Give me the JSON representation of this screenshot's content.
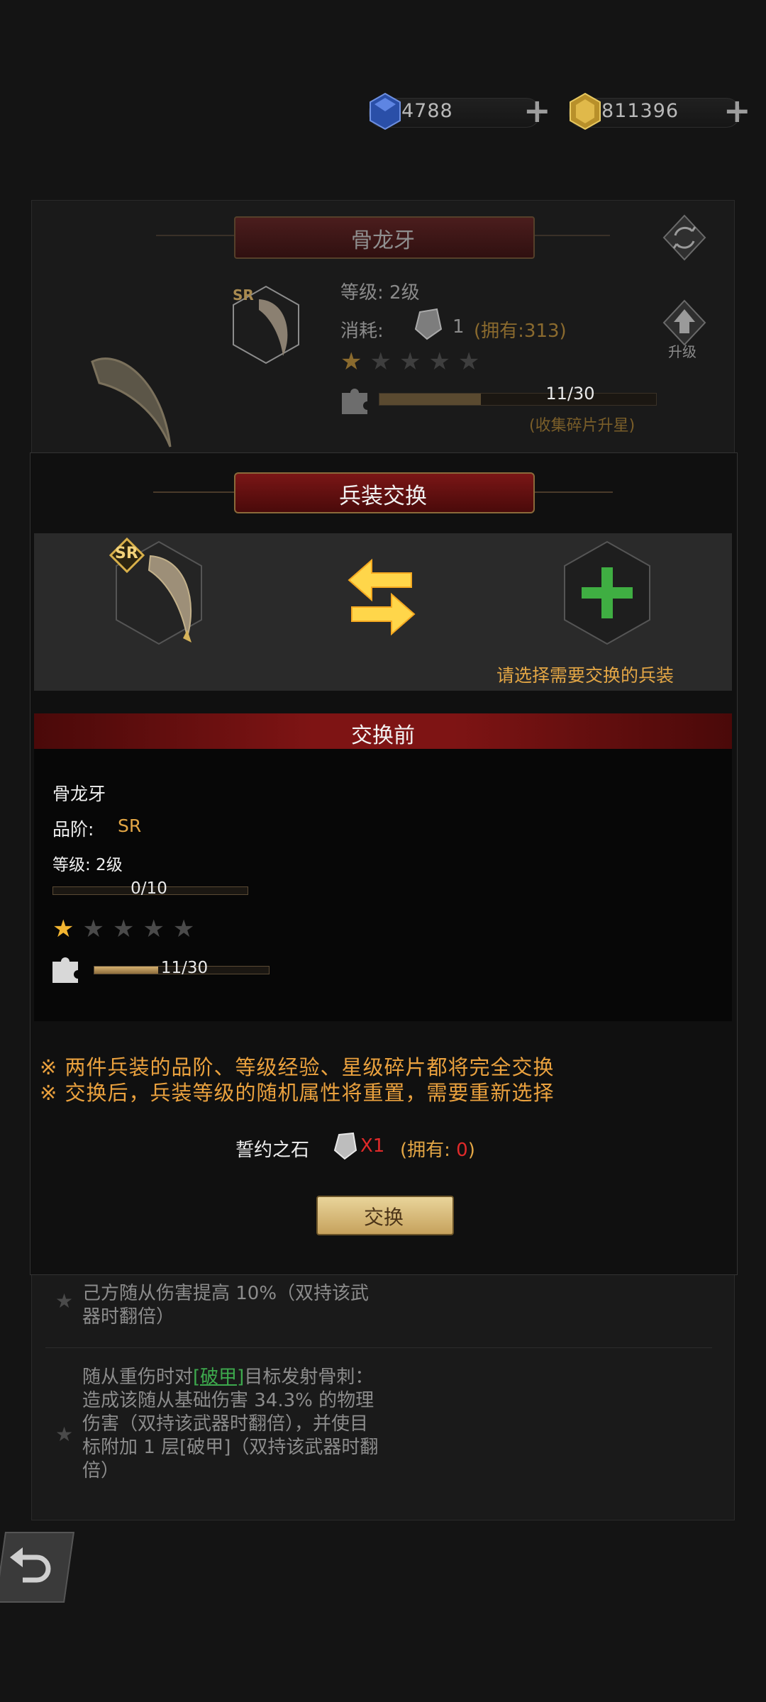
{
  "currency": {
    "gems": "4788",
    "gold": "811396"
  },
  "item_panel": {
    "title": "骨龙牙",
    "rarity_badge": "SR",
    "level_label": "等级: 2级",
    "cost_label": "消耗:",
    "cost_amount": "1",
    "cost_owned": "(拥有:313)",
    "stars_filled": 1,
    "stars_total": 5,
    "fragments": "11/30",
    "fragments_progress": 0.3667,
    "fragment_hint": "(收集碎片升星)",
    "upgrade_label": "升级",
    "bonuses": [
      {
        "text": "己方随从伤害提高 10%（双持该武器时翻倍）"
      },
      {
        "before": "随从重伤时对",
        "link": "[破甲]",
        "after": "目标发射骨刺：造成该随从基础伤害 34.3% 的物理伤害（双持该武器时翻倍），并使目标附加 1 层[破甲]（双持该武器时翻倍）"
      }
    ]
  },
  "modal": {
    "title": "兵装交换",
    "select_hint": "请选择需要交换的兵装",
    "before_header": "交换前",
    "before": {
      "name": "骨龙牙",
      "quality_label": "品阶:",
      "quality_value": "SR",
      "level": "等级: 2级",
      "exp": "0/10",
      "exp_progress": 0,
      "stars_filled": 1,
      "stars_total": 5,
      "fragments": "11/30",
      "fragments_progress": 0.3667
    },
    "notes": [
      "※ 两件兵装的品阶、等级经验、星级碎片都将完全交换",
      "※ 交换后，兵装等级的随机属性将重置，需要重新选择"
    ],
    "cost_label": "誓约之石",
    "cost_qty": "X1",
    "owned_prefix": "(拥有: ",
    "owned_value": "0",
    "owned_suffix": ")",
    "swap_button": "交换"
  }
}
